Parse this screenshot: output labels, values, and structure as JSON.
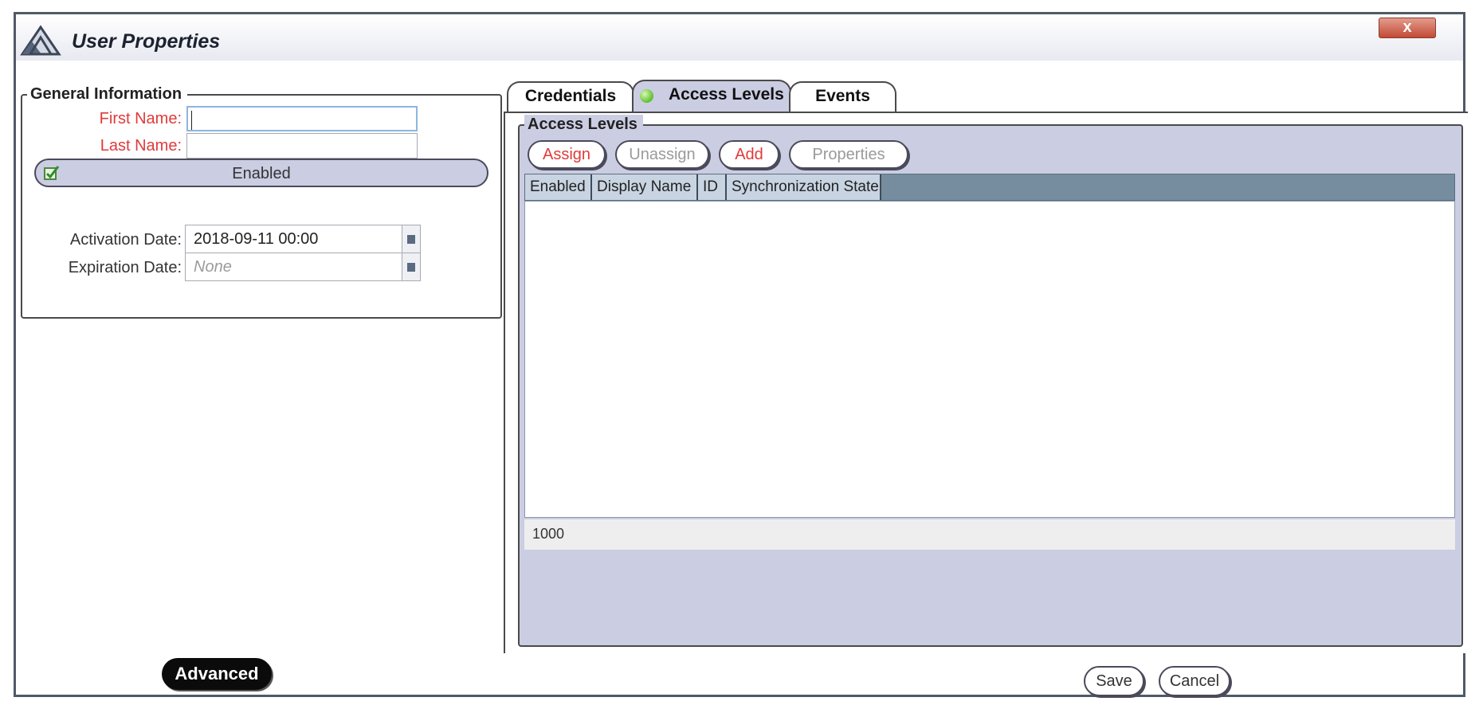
{
  "window": {
    "title": "User Properties",
    "close_label": "x",
    "icons": {
      "app": "app-logo-icon",
      "close": "close-icon"
    }
  },
  "general": {
    "legend": "General Information",
    "first_name": {
      "label": "First Name:",
      "value": ""
    },
    "last_name": {
      "label": "Last Name:",
      "value": ""
    },
    "enabled": {
      "label": "Enabled",
      "checked": true
    },
    "activation": {
      "label": "Activation Date:",
      "value": "2018-09-11 00:00"
    },
    "expiration": {
      "label": "Expiration Date:",
      "value": "None"
    },
    "colors": {
      "required_label": "#e13a3a",
      "toggle_bg": "#cbcde3"
    }
  },
  "tabs": [
    {
      "label": "Credentials",
      "active": false
    },
    {
      "label": "Access Levels",
      "active": true,
      "status": "green"
    },
    {
      "label": "Events",
      "active": false
    }
  ],
  "access_levels": {
    "legend": "Access Levels",
    "buttons": {
      "assign": "Assign",
      "unassign": "Unassign",
      "add": "Add",
      "properties": "Properties"
    },
    "columns": [
      "Enabled",
      "Display Name",
      "ID",
      "Synchronization State"
    ],
    "rows": [],
    "footer": "1000",
    "colors": {
      "panel_bg": "#cbcde3",
      "header_bg": "#758d9e",
      "accent_red": "#e13a3a"
    }
  },
  "footer": {
    "advanced": "Advanced",
    "save": "Save",
    "cancel": "Cancel"
  }
}
